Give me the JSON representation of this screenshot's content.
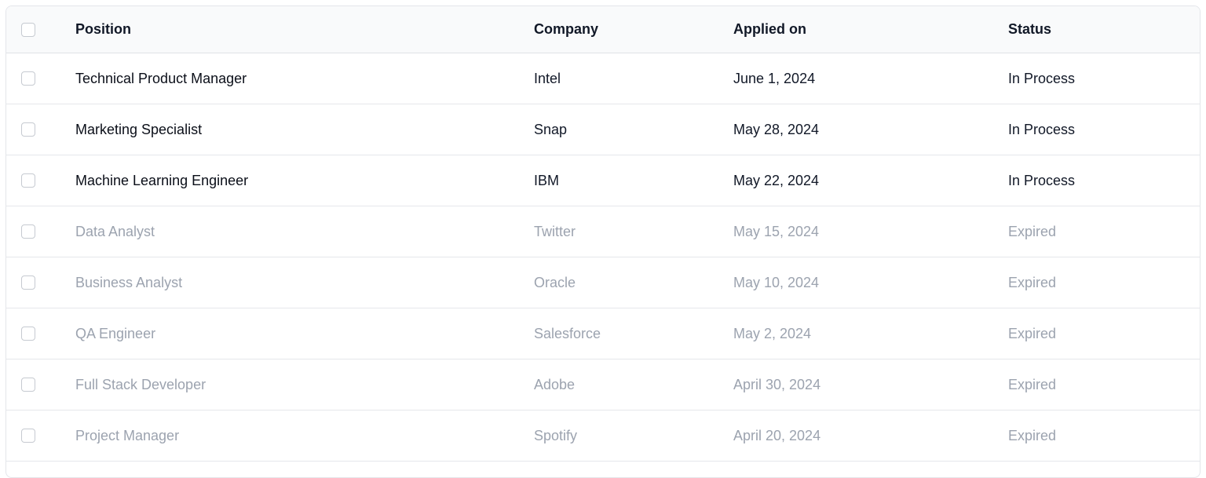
{
  "table": {
    "columns": {
      "position": "Position",
      "company": "Company",
      "applied_on": "Applied on",
      "status": "Status"
    },
    "rows": [
      {
        "position": "Technical Product Manager",
        "company": "Intel",
        "applied_on": "June 1, 2024",
        "status": "In Process",
        "state": "active"
      },
      {
        "position": "Marketing Specialist",
        "company": "Snap",
        "applied_on": "May 28, 2024",
        "status": "In Process",
        "state": "active"
      },
      {
        "position": "Machine Learning Engineer",
        "company": "IBM",
        "applied_on": "May 22, 2024",
        "status": "In Process",
        "state": "active"
      },
      {
        "position": "Data Analyst",
        "company": "Twitter",
        "applied_on": "May 15, 2024",
        "status": "Expired",
        "state": "expired"
      },
      {
        "position": "Business Analyst",
        "company": "Oracle",
        "applied_on": "May 10, 2024",
        "status": "Expired",
        "state": "expired"
      },
      {
        "position": "QA Engineer",
        "company": "Salesforce",
        "applied_on": "May 2, 2024",
        "status": "Expired",
        "state": "expired"
      },
      {
        "position": "Full Stack Developer",
        "company": "Adobe",
        "applied_on": "April 30, 2024",
        "status": "Expired",
        "state": "expired"
      },
      {
        "position": "Project Manager",
        "company": "Spotify",
        "applied_on": "April 20, 2024",
        "status": "Expired",
        "state": "expired"
      }
    ]
  },
  "colors": {
    "active_text": "#111827",
    "expired_text": "#9ca3af",
    "header_bg": "#f9fafb",
    "border": "#e5e7eb"
  }
}
